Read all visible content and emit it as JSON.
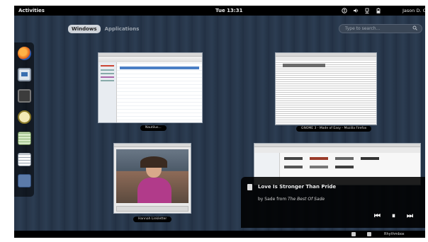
{
  "topbar": {
    "activities": "Activities",
    "clock": "Tue 13:31",
    "user": "Jason D. Clin",
    "tray_icons": [
      "accessibility-icon",
      "volume-icon",
      "network-icon",
      "battery-icon"
    ]
  },
  "overview": {
    "tab_windows": "Windows",
    "tab_applications": "Applications",
    "search_placeholder": "Type to search..."
  },
  "dash_apps": [
    "firefox-icon",
    "display-icon",
    "terminal-icon",
    "audio-icon",
    "spreadsheet-icon",
    "document-icon",
    "folder-icon"
  ],
  "windows": [
    {
      "caption": "Nautilus..."
    },
    {
      "caption": "GNOME 3 - Made of Easy - Mozilla Firefox"
    },
    {
      "caption": "Hannah Linkletter"
    },
    {
      "caption": ""
    }
  ],
  "notification": {
    "title": "Love Is Stronger Than Pride",
    "by": "by",
    "artist": "Sade",
    "from": "from",
    "album": "The Best Of Sade",
    "prev": "⏮",
    "pause": "⏸",
    "next": "⏭"
  },
  "message_tray": {
    "label": "Rhythmbox"
  },
  "colors": {
    "desktop": "#263447",
    "accent": "#cfd4da"
  }
}
